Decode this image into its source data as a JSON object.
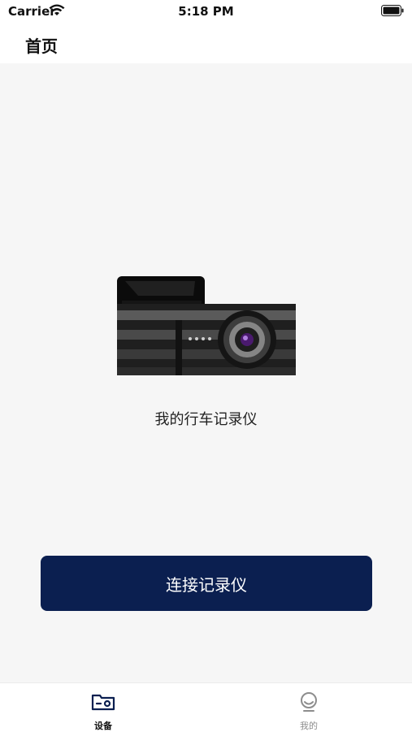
{
  "status_bar": {
    "carrier": "Carrier",
    "time": "5:18 PM",
    "wifi_icon": "wifi-icon",
    "battery_icon": "battery-icon"
  },
  "nav": {
    "title": "首页"
  },
  "main": {
    "device_image_icon": "dashcam-image",
    "device_name": "我的行车记录仪",
    "connect_label": "连接记录仪",
    "accent_color": "#0b1f50"
  },
  "tab_bar": {
    "items": [
      {
        "label": "设备",
        "icon": "device-folder-icon",
        "active": true
      },
      {
        "label": "我的",
        "icon": "profile-icon",
        "active": false
      }
    ]
  }
}
